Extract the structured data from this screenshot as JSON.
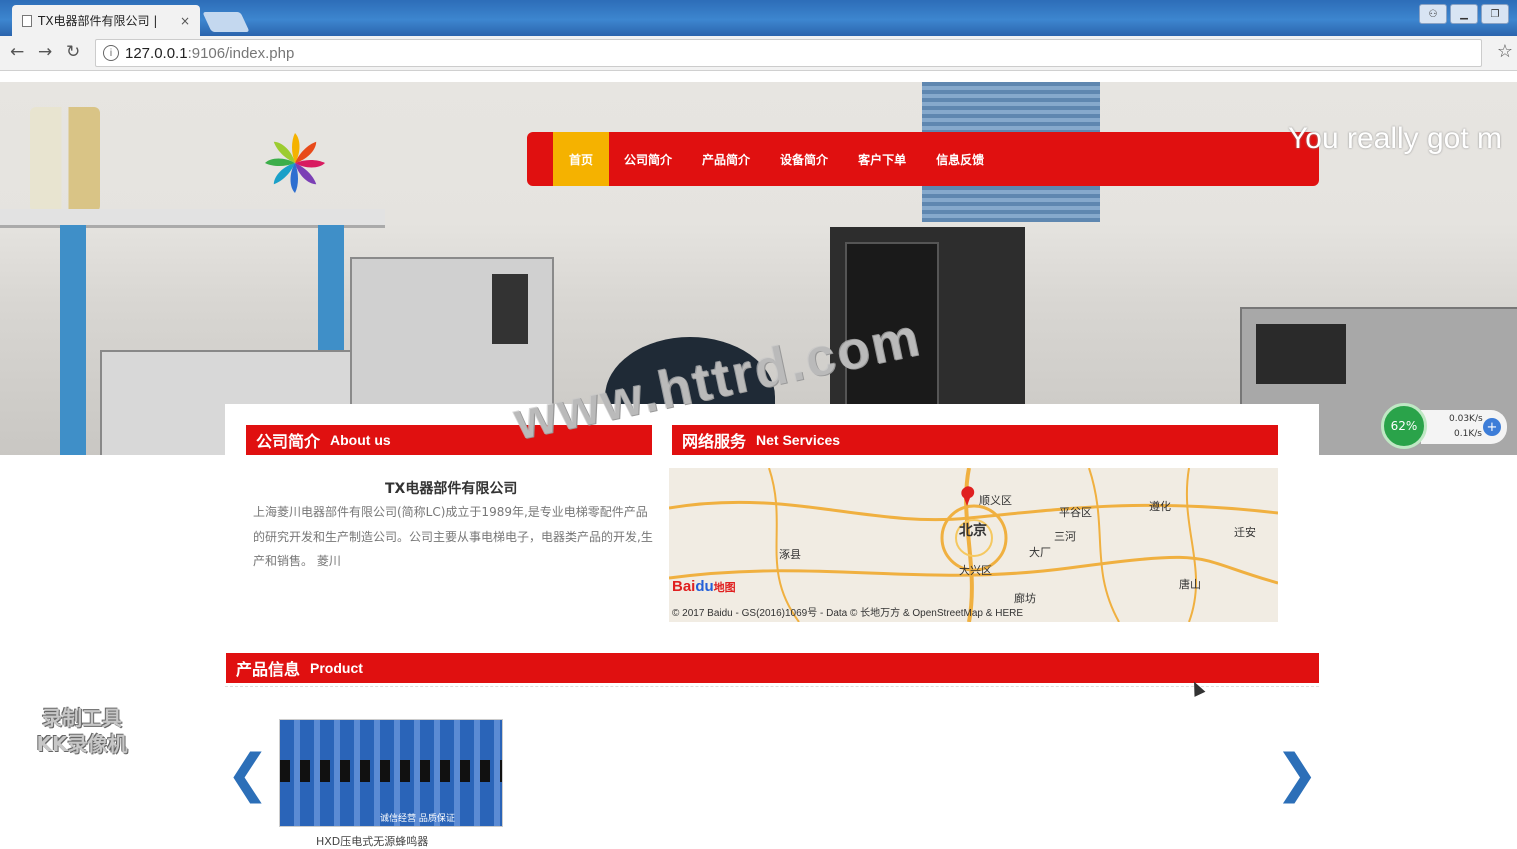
{
  "browser": {
    "tab_title": "TX电器部件有限公司 | ",
    "tab_close": "×",
    "url_host": "127.0.0.1",
    "url_path": ":9106/index.php"
  },
  "nav": {
    "items": [
      "首页",
      "公司简介",
      "产品简介",
      "设备简介",
      "客户下单",
      "信息反馈"
    ],
    "active_index": 0
  },
  "marquee": "You really got m",
  "about": {
    "title_zh": "公司简介",
    "title_en": "About us",
    "company_name": "TX电器部件有限公司",
    "description": "上海菱川电器部件有限公司(简称LC)成立于1989年,是专业电梯零配件产品的研究开发和生产制造公司。公司主要从事电梯电子，电器类产品的开发,生产和销售。 菱川"
  },
  "services": {
    "title_zh": "网络服务",
    "title_en": "Net Services",
    "map_credit": "© 2017 Baidu - GS(2016)1069号 - Data © 长地万方 & OpenStreetMap & HERE",
    "map_logo_bai": "Bai",
    "map_logo_du": "du",
    "map_logo_suffix": "地图",
    "cities": [
      "北京",
      "大兴区",
      "廊坊",
      "唐山",
      "迁安",
      "遵化",
      "平谷区",
      "三河",
      "顺义区",
      "涿县",
      "大厂"
    ]
  },
  "product": {
    "title_zh": "产品信息",
    "title_en": "Product",
    "items": [
      {
        "caption": "HXD压电式无源蜂鸣器",
        "tag": "诚信经营 品质保证"
      }
    ],
    "prev_arrow": "❮",
    "next_arrow": "❯"
  },
  "speed_widget": {
    "percent": "62%",
    "up": "0.03K/s",
    "down": "0.1K/s"
  },
  "overlays": {
    "watermark": "www.httrd.com",
    "recorder": "录制工具 KK录像机"
  },
  "colors": {
    "nav_red": "#e01010",
    "nav_active": "#f5b200",
    "arrow_blue": "#2c6fb8"
  }
}
